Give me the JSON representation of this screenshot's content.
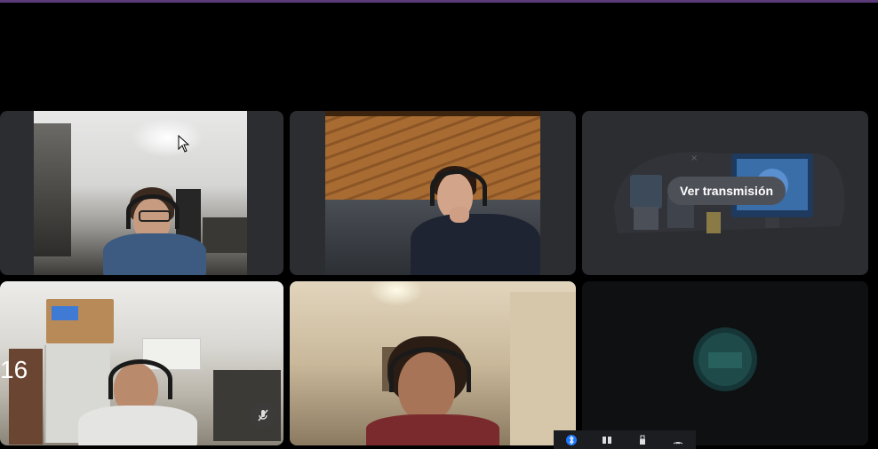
{
  "tiles": {
    "stream_card": {
      "button_label": "Ver transmisión"
    },
    "participant_number": "16"
  },
  "icons": {
    "cursor": "cursor-icon",
    "mute": "muted-microphone-icon",
    "stream_artwork": "monitor-illustration-icon",
    "avatar": "server-avatar-icon",
    "tray": [
      "bluetooth-icon",
      "network-icon",
      "usb-icon",
      "wifi-icon"
    ]
  },
  "colors": {
    "accent": "#5b3a7a",
    "tile_bg": "#2b2d31",
    "stream_button_bg": "#4e5058",
    "bluetooth": "#1e78ff"
  }
}
